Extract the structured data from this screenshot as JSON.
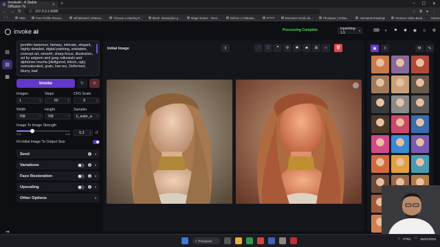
{
  "browser": {
    "tab_title": "InvokeAI - A Stable Diffusion To",
    "new_tab": "+",
    "url": "127.0.0.1:9090",
    "bookmarks": [
      "Todo",
      "Free Profile Pictura...",
      "Whiteboard | Sharea...",
      "Choose a Starting P...",
      "Bloch: Ilustrações p...",
      "Magic Eraser - Rem...",
      "Deforic | A fabulou...",
      "IFTTT",
      "Remover Fundo de...",
      "Photopea | Online...",
      "Animated Drawings",
      "Remove Video Back..."
    ],
    "bookmarks_other": "Outros favoritos"
  },
  "app": {
    "logo_pre": "invoke",
    "logo_post": "ai",
    "status": "Processing Complete",
    "model": "inpainting-1.5"
  },
  "prompt": {
    "text": "jennifer lawrence, fantasy, intricate, elegant, highly detailed, digital painting, artstation, concept art, smooth, sharp focus, illustration, art by artgerm and greg rutkowski and alphonse mucha [disfigured, kitsch, ugly, oversaturated, grain, low-res, Deformed, blurry, bad"
  },
  "controls": {
    "invoke_label": "Invoke",
    "images_label": "Images",
    "images_value": "1",
    "steps_label": "Steps",
    "steps_value": "50",
    "cfg_label": "CFG Scale",
    "cfg_value": "8",
    "width_label": "Width",
    "width_value": "768",
    "height_label": "Height",
    "height_value": "768",
    "sampler_label": "Sampler",
    "sampler_value": "k_euler_a",
    "strength_label": "Image To Image Strength",
    "strength_value": "0.3",
    "strength_fraction": 0.3,
    "strength_min": "0.01",
    "strength_max": "0.99",
    "fit_label": "Fit Initial Image To Output Size"
  },
  "accordions": [
    {
      "label": "Seed"
    },
    {
      "label": "Variations"
    },
    {
      "label": "Face Restoration"
    },
    {
      "label": "Upscaling"
    },
    {
      "label": "Other Options"
    }
  ],
  "workarea": {
    "title": "Initial Image"
  },
  "taskbar": {
    "search": "Pesquisar",
    "lang": "PTB2",
    "time": "",
    "date": "06/01/2023"
  },
  "colors": {
    "accent": "#6238c8",
    "status": "#4ade50",
    "delete": "#e0454b"
  }
}
